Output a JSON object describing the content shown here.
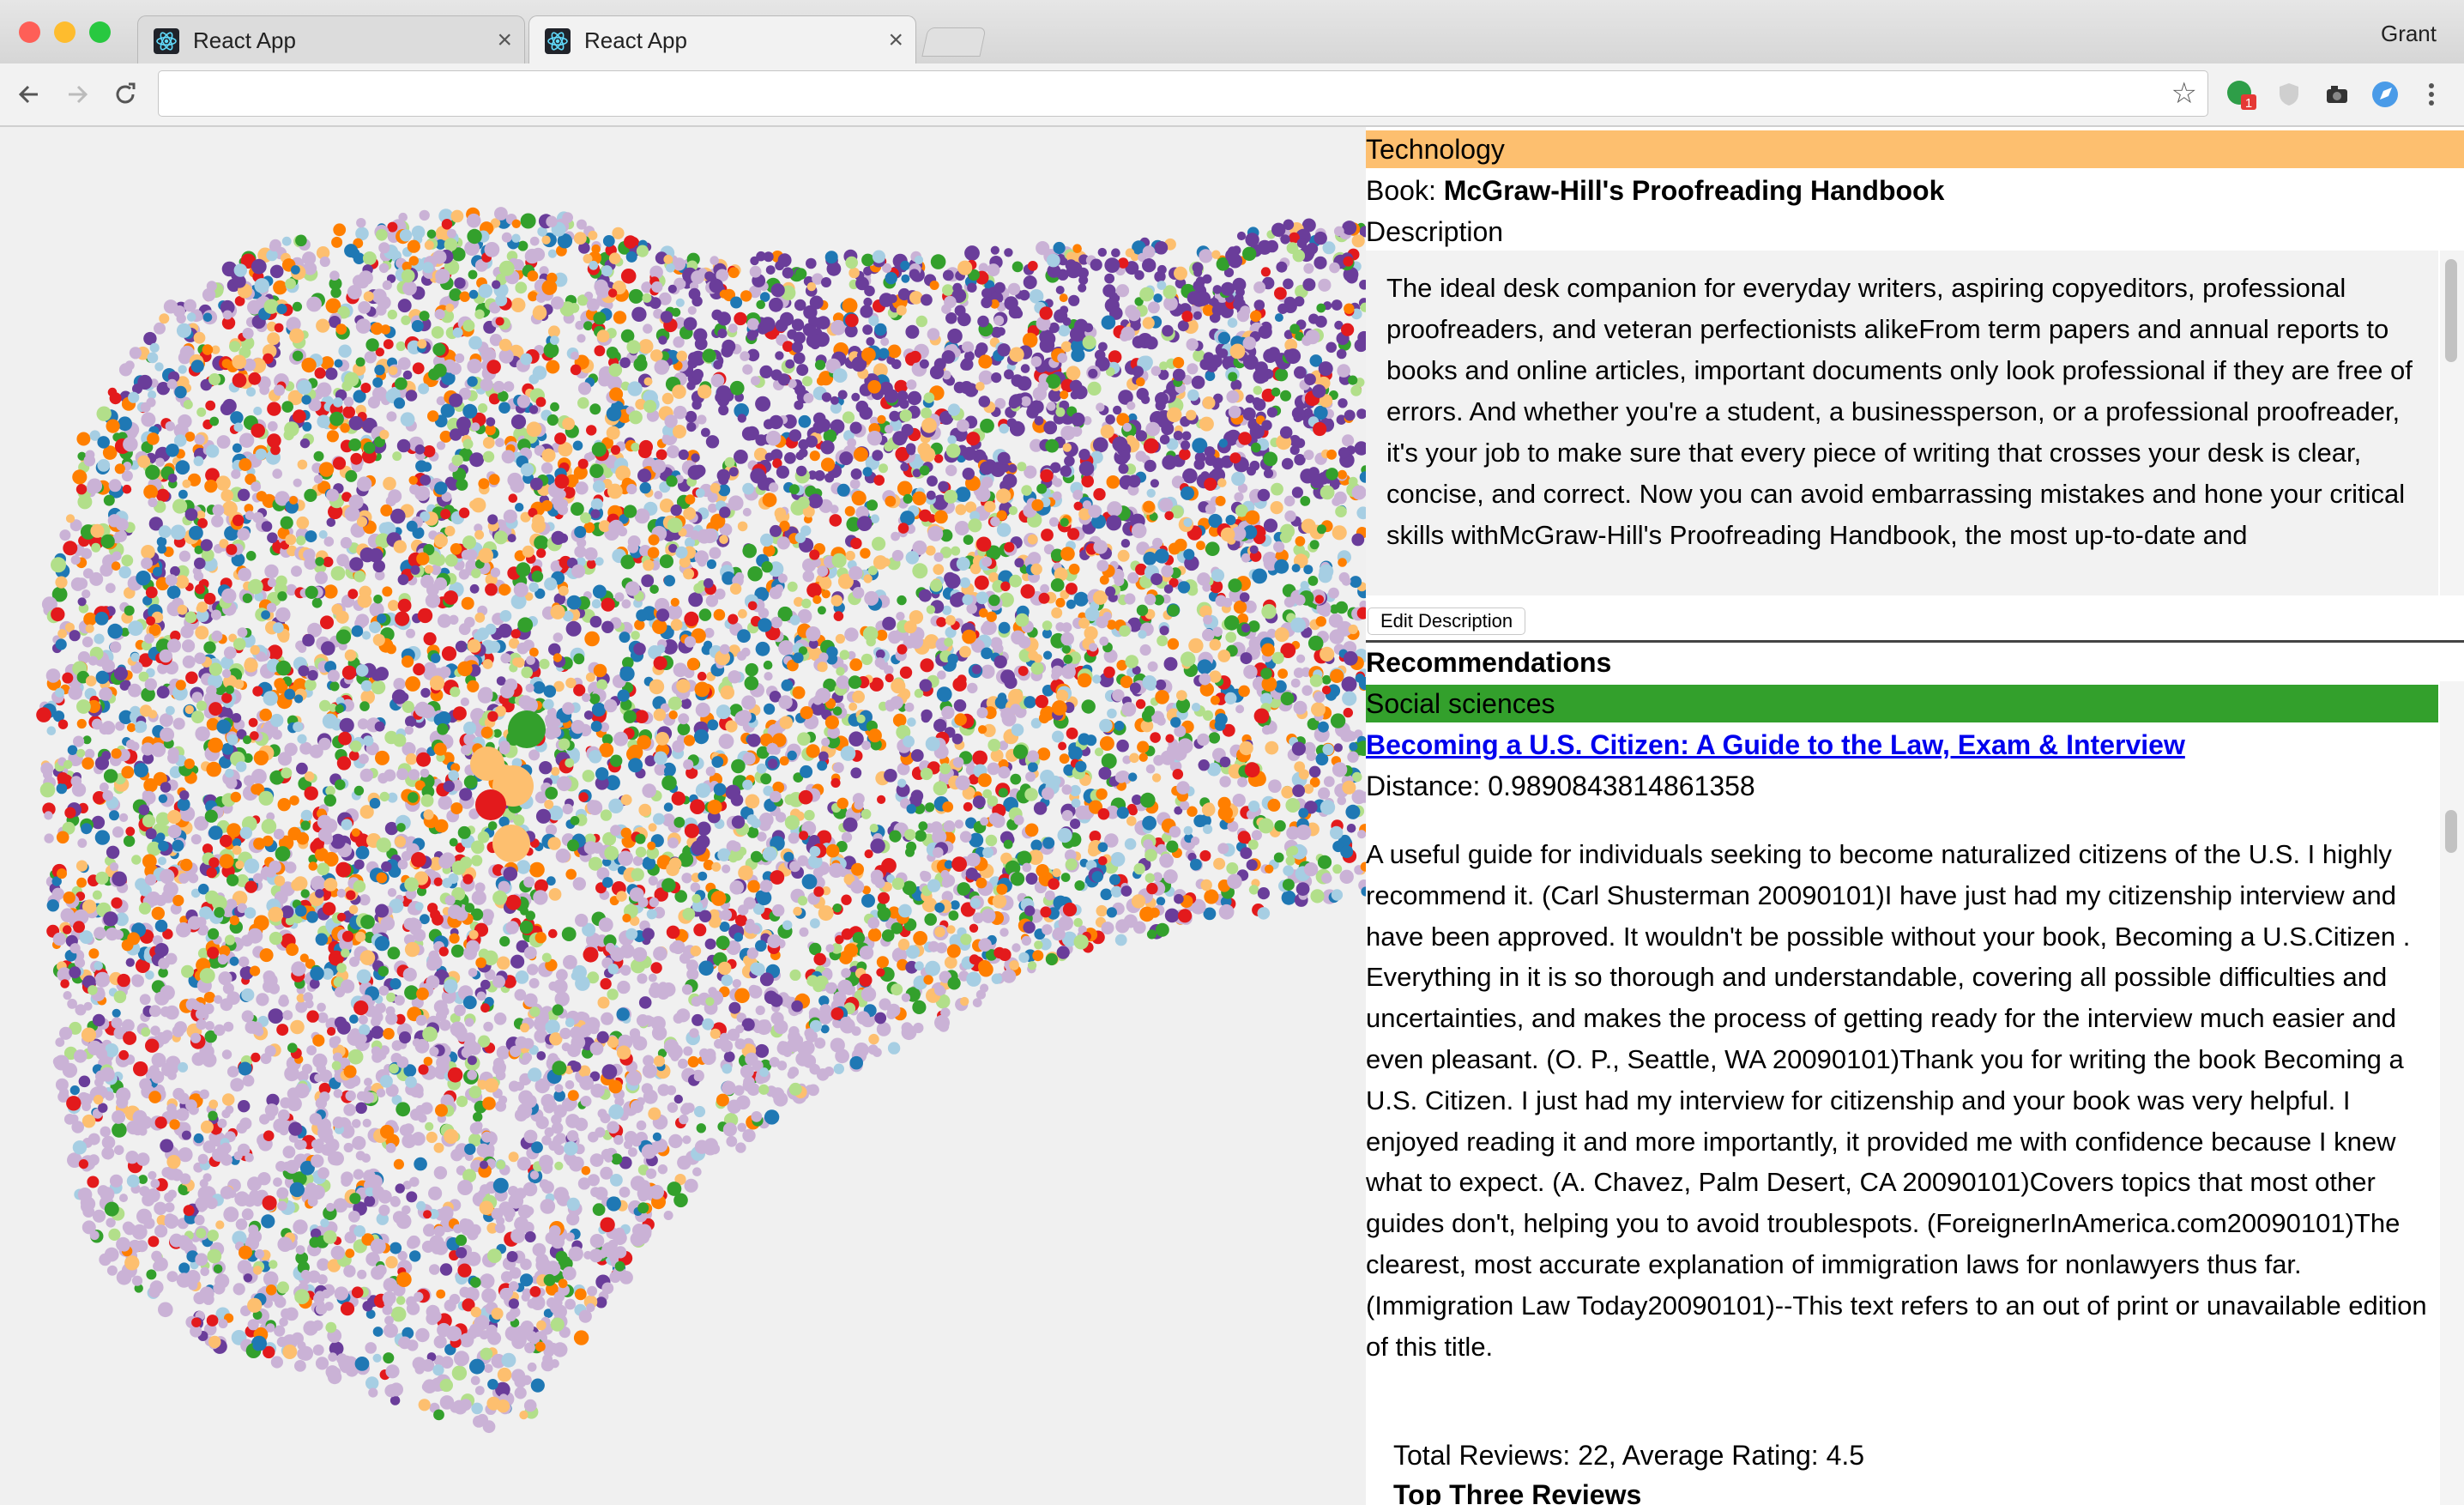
{
  "browser": {
    "tabs": [
      {
        "title": "React App"
      },
      {
        "title": "React App"
      }
    ],
    "profile_name": "Grant",
    "address_value": "",
    "extension_badge": "1",
    "colors": {
      "close": "#fe5f57",
      "minimize": "#febc2e",
      "maximize": "#28c840"
    }
  },
  "book": {
    "category": "Technology",
    "category_color": "#fdbf6f",
    "label": "Book:",
    "title": "McGraw-Hill's Proofreading Handbook",
    "description_heading": "Description",
    "description": "The ideal desk companion for everyday writers, aspiring copyeditors, professional proofreaders, and veteran perfectionists alikeFrom term papers and annual reports to books and online articles, important documents only look professional if they are free of errors. And whether you're a student, a businessperson, or a professional proofreader, it's your job to make sure that every piece of writing that crosses your desk is clear, concise, and correct. Now you can avoid embarrassing mistakes and hone your critical skills withMcGraw-Hill's Proofreading Handbook, the most up-to-date and",
    "edit_button": "Edit Description"
  },
  "recommendations": {
    "heading": "Recommendations",
    "items": [
      {
        "category": "Social sciences",
        "category_color": "#33a02c",
        "title": "Becoming a U.S. Citizen: A Guide to the Law, Exam & Interview",
        "distance": "Distance: 0.9890843814861358",
        "description": "A useful guide for individuals seeking to become naturalized citizens of the U.S. I highly recommend it. (Carl Shusterman 20090101)I have just had my citizenship interview and have been approved. It wouldn't be possible without your book, Becoming a U.S.Citizen . Everything in it is so thorough and understandable, covering all possible difficulties and uncertainties, and makes the process of getting ready for the interview much easier and even pleasant. (O. P., Seattle, WA 20090101)Thank you for writing the book Becoming a U.S. Citizen. I just had my interview for citizenship and your book was very helpful. I enjoyed reading it and more importantly, it provided me with confidence because I knew what to expect. (A. Chavez, Palm Desert, CA 20090101)Covers topics that most other guides don't, helping you to avoid troublespots. (ForeignerInAmerica.com20090101)The clearest, most accurate explanation of immigration laws for nonlawyers thus far. (Immigration Law Today20090101)--This text refers to an out of print or unavailable edition of this title.",
        "reviews_summary": "Total Reviews: 22, Average Rating: 4.5",
        "top_reviews_heading": "Top Three Reviews"
      }
    ]
  },
  "visualization": {
    "palette": [
      "#cab2d6",
      "#cab2d6",
      "#cab2d6",
      "#ff7f00",
      "#fdbf6f",
      "#b2df8a",
      "#33a02c",
      "#6a3d9a",
      "#1f78b4",
      "#a6cee3",
      "#e31a1c"
    ],
    "highlight_colors": [
      "#33a02c",
      "#fdbf6f",
      "#e31a1c"
    ]
  }
}
